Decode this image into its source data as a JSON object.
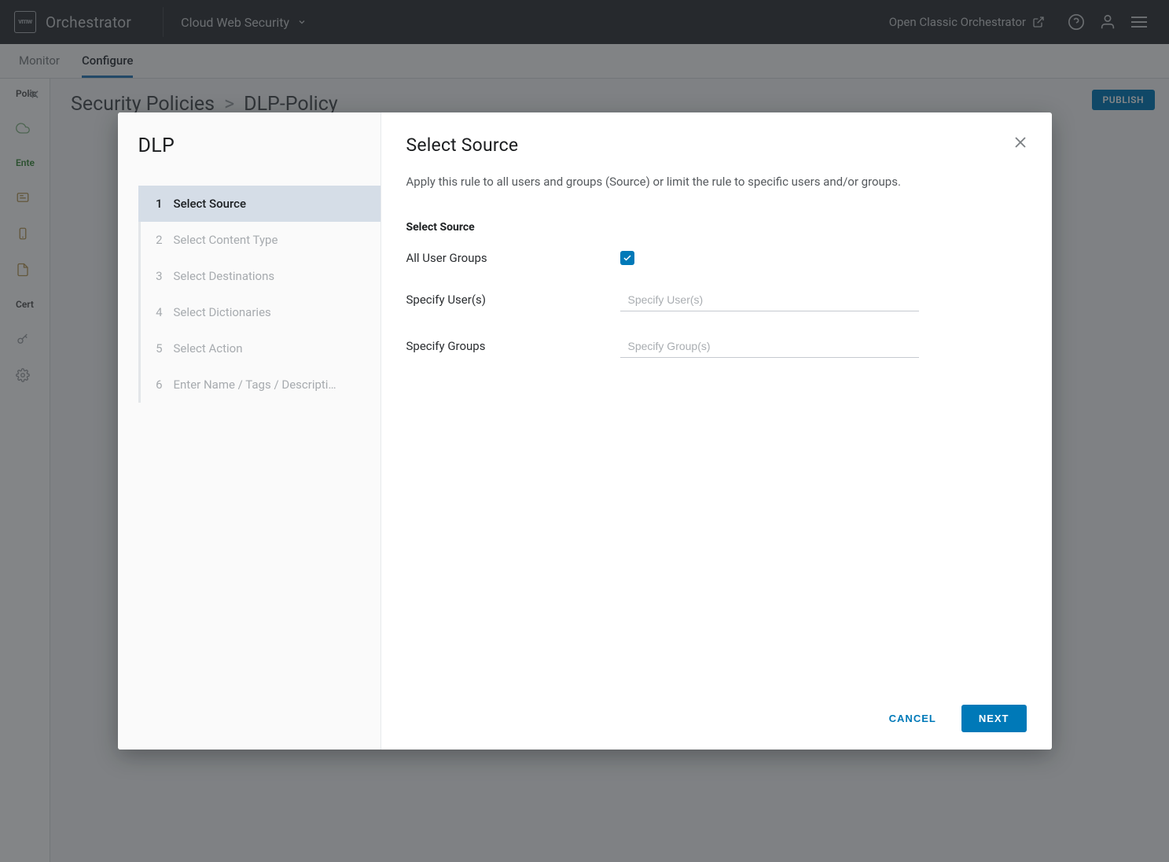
{
  "header": {
    "logo_text": "vmw",
    "app_title": "Orchestrator",
    "product_name": "Cloud Web Security",
    "classic_link": "Open Classic Orchestrator"
  },
  "tabs": {
    "monitor": "Monitor",
    "configure": "Configure"
  },
  "sidebar": {
    "group1": "Polic",
    "group2": "Ente",
    "group3": "Cert"
  },
  "breadcrumb": {
    "parent": "Security Policies",
    "sep": ">",
    "current": "DLP-Policy"
  },
  "publish_label": "PUBLISH",
  "modal": {
    "left_title": "DLP",
    "steps": [
      {
        "num": "1",
        "label": "Select Source"
      },
      {
        "num": "2",
        "label": "Select Content Type"
      },
      {
        "num": "3",
        "label": "Select Destinations"
      },
      {
        "num": "4",
        "label": "Select Dictionaries"
      },
      {
        "num": "5",
        "label": "Select Action"
      },
      {
        "num": "6",
        "label": "Enter Name / Tags / Descripti…"
      }
    ],
    "panel_title": "Select Source",
    "panel_desc": "Apply this rule to all users and groups (Source) or limit the rule to specific users and/or groups.",
    "section_heading": "Select Source",
    "rows": {
      "all_user_groups_label": "All User Groups",
      "specify_users_label": "Specify User(s)",
      "specify_users_placeholder": "Specify User(s)",
      "specify_groups_label": "Specify Groups",
      "specify_groups_placeholder": "Specify Group(s)"
    },
    "footer": {
      "cancel": "CANCEL",
      "next": "NEXT"
    }
  }
}
